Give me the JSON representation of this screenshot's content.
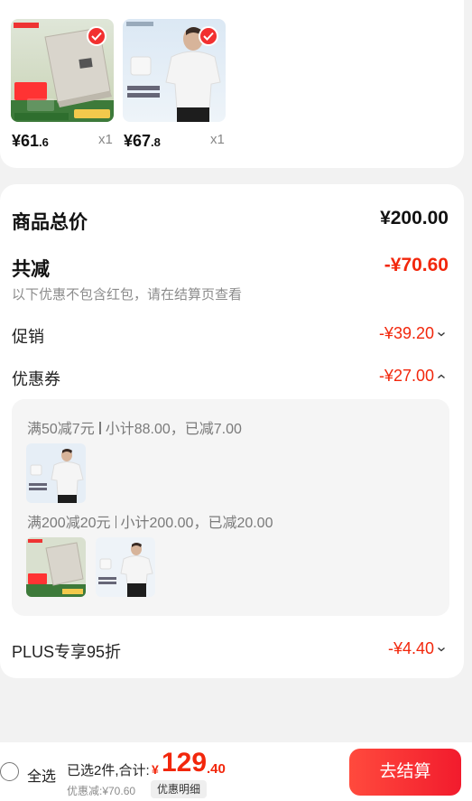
{
  "products": [
    {
      "price_int": "¥61",
      "price_dec": ".6",
      "qty": "x1",
      "image_text": [
        "DELI",
        "65折",
        "72"
      ]
    },
    {
      "price_int": "¥67",
      "price_dec": ".8",
      "qty": "x1",
      "image_text": [
        "柔软舒适",
        "触感柔软",
        "舒适透气"
      ]
    }
  ],
  "summary": {
    "total_label": "商品总价",
    "total_value": "¥200.00",
    "reduce_label": "共减",
    "reduce_value": "-¥70.60",
    "note": "以下优惠不包含红包，请在结算页查看",
    "promo_label": "促销",
    "promo_value": "-¥39.20",
    "coupon_label": "优惠券",
    "coupon_value": "-¥27.00",
    "coupon_rules": [
      {
        "title": "满50减7元",
        "detail": "小计88.00，已减7.00"
      },
      {
        "title": "满200减20元",
        "detail": "小计200.00，已减20.00"
      }
    ],
    "plus_label": "PLUS专享95折",
    "plus_value": "-¥4.40"
  },
  "bottom": {
    "select_all": "全选",
    "selected_text": "已选2件,合计:",
    "currency": "¥",
    "total_int": "129",
    "total_dec": ".40",
    "discount_text": "优惠减:¥70.60",
    "detail_button": "优惠明细",
    "checkout_button": "去结算"
  },
  "colors": {
    "accent_red": "#f2270c",
    "checkout_gradient_start": "#ff4a3d",
    "checkout_gradient_end": "#f21b2d"
  },
  "icons": [
    "check-icon",
    "chevron-down-icon",
    "chevron-up-icon",
    "radio-unchecked-icon"
  ]
}
